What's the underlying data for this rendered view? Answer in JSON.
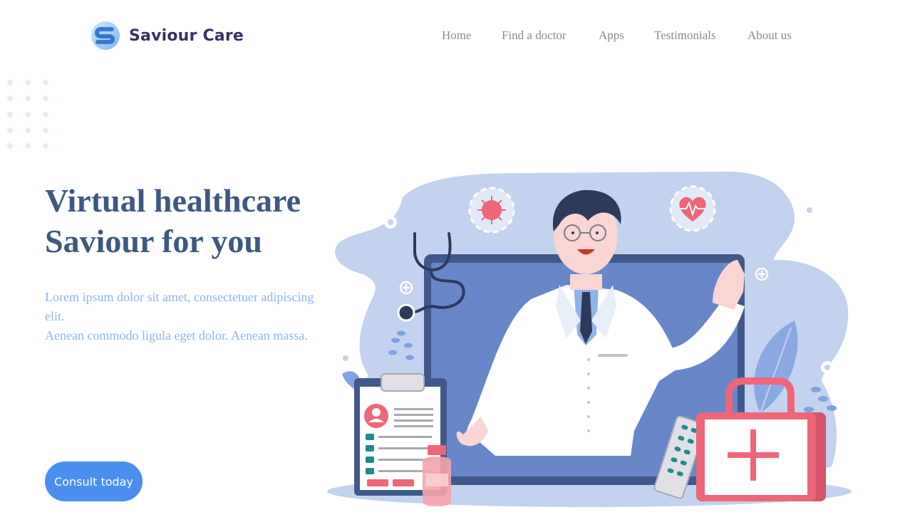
{
  "brand": {
    "name": "Saviour Care",
    "logo_letter": "S"
  },
  "nav": {
    "home": "Home",
    "find_doctor": "Find a doctor",
    "apps": "Apps",
    "testimonials": "Testimonials",
    "about": "About us"
  },
  "hero": {
    "title_line1": "Virtual healthcare",
    "title_line2": "Saviour for you",
    "text_line1": "Lorem ipsum dolor sit amet, consectetuer adipiscing elit.",
    "text_line2": "Aenean commodo ligula eget dolor. Aenean massa.",
    "cta_label": "Consult today"
  },
  "colors": {
    "brand_text": "#3b2f63",
    "title": "#3e5880",
    "body_text": "#8fb4ea",
    "button": "#4a8ff0",
    "nav_text": "#8a8a8a",
    "blob": "#c3d2ee",
    "screen": "#6787c9",
    "accent_red": "#ef6679"
  }
}
